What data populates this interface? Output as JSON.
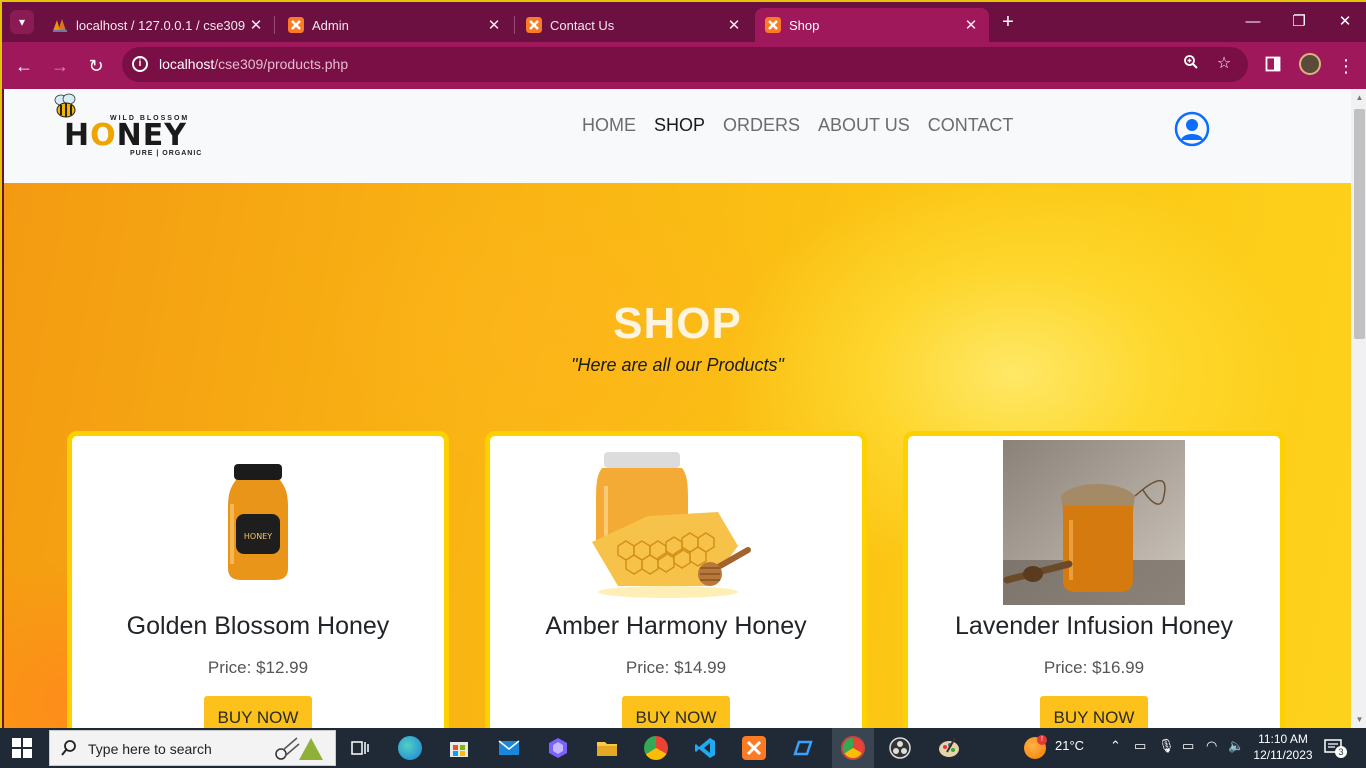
{
  "browser": {
    "tabs": [
      {
        "title": "localhost / 127.0.0.1 / cse309 / ",
        "favicon": "phpmyadmin-icon",
        "active": false
      },
      {
        "title": "Admin",
        "favicon": "xampp-icon",
        "active": false
      },
      {
        "title": "Contact Us",
        "favicon": "xampp-icon",
        "active": false
      },
      {
        "title": "Shop",
        "favicon": "xampp-icon",
        "active": true
      }
    ],
    "url_host": "localhost",
    "url_path": "/cse309/products.php",
    "colors": {
      "frame": "#6b1040",
      "toolbar": "#a0185c",
      "omnibox": "#7a0f45"
    }
  },
  "site": {
    "logo": {
      "top_text": "WILD BLOSSOM",
      "main_text_a": "H",
      "main_text_o": "O",
      "main_text_b": "NEY",
      "bottom_text": "PURE | ORGANIC"
    },
    "nav": [
      {
        "label": "HOME",
        "active": false
      },
      {
        "label": "SHOP",
        "active": true
      },
      {
        "label": "ORDERS",
        "active": false
      },
      {
        "label": "ABOUT US",
        "active": false
      },
      {
        "label": "CONTACT",
        "active": false
      }
    ],
    "hero": {
      "title": "SHOP",
      "subtitle": "\"Here are all our Products\""
    },
    "products": [
      {
        "name": "Golden Blossom Honey",
        "price": "Price: $12.99",
        "button": "BUY NOW",
        "jar_label": "HONEY"
      },
      {
        "name": "Amber Harmony Honey",
        "price": "Price: $14.99",
        "button": "BUY NOW"
      },
      {
        "name": "Lavender Infusion Honey",
        "price": "Price: $16.99",
        "button": "BUY NOW"
      }
    ],
    "colors": {
      "accent": "#fcc21b",
      "card_border": "#fdd000",
      "hero_text": "#fff4df"
    }
  },
  "taskbar": {
    "search_placeholder": "Type here to search",
    "weather": "21°C",
    "time": "11:10 AM",
    "date": "12/11/2023",
    "notifications": "3"
  }
}
